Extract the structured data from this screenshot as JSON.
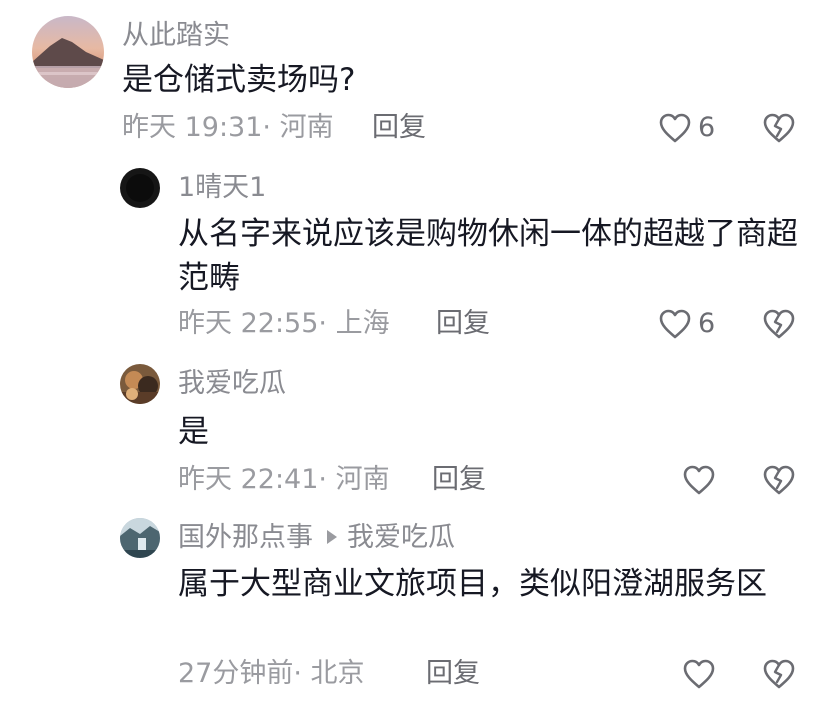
{
  "comments": [
    {
      "username": "从此踏实",
      "text": "是仓储式卖场吗?",
      "time": "昨天 19:31",
      "location": "· 河南",
      "reply": "回复",
      "likes": "6"
    },
    {
      "username": "1晴天1",
      "text": "从名字来说应该是购物休闲一体的超越了商超范畴",
      "time": "昨天 22:55",
      "location": "· 上海",
      "reply": "回复",
      "likes": "6"
    },
    {
      "username": "我爱吃瓜",
      "text": "是",
      "time": "昨天 22:41",
      "location": "· 河南",
      "reply": "回复"
    },
    {
      "username": "国外那点事",
      "reply_to": "我爱吃瓜",
      "text": "属于大型商业文旅项目，类似阳澄湖服务区",
      "time": "27分钟前",
      "location": "· 北京",
      "reply": "回复"
    }
  ],
  "icons": {
    "like": "heart-outline-icon",
    "dislike": "broken-heart-icon"
  },
  "colors": {
    "primary_text": "#161823",
    "secondary_text": "#8a8b91",
    "icon": "#6b6c72"
  }
}
